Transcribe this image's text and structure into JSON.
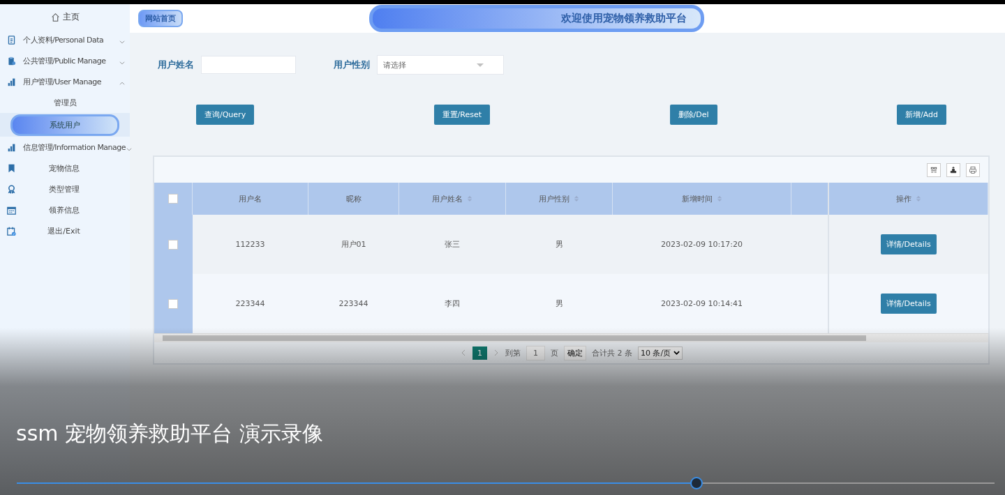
{
  "sidebar": {
    "home": "主页",
    "items": [
      {
        "kind": "group",
        "label": "个人资料/Personal Data",
        "expanded": false
      },
      {
        "kind": "group",
        "label": "公共管理/Public Manage",
        "expanded": false
      },
      {
        "kind": "group",
        "label": "用户管理/User Manage",
        "expanded": true,
        "children": [
          {
            "label": "管理员",
            "selected": false
          },
          {
            "label": "系统用户",
            "selected": true
          }
        ]
      },
      {
        "kind": "group",
        "label": "信息管理/Information Manage",
        "expanded": false
      },
      {
        "kind": "link",
        "label": "宠物信息"
      },
      {
        "kind": "link",
        "label": "类型管理"
      },
      {
        "kind": "link",
        "label": "领养信息"
      },
      {
        "kind": "link",
        "label": "退出/Exit"
      }
    ]
  },
  "header": {
    "home_link": "网站首页",
    "title": "欢迎使用宠物领养救助平台"
  },
  "filters": [
    {
      "kind": "text",
      "label": "用户姓名"
    },
    {
      "kind": "select",
      "label": "用户性别",
      "placeholder": "请选择"
    }
  ],
  "buttons": [
    "查询/Query",
    "重置/Reset",
    "删除/Del",
    "新增/Add"
  ],
  "table": {
    "header_checked": false,
    "columns": [
      {
        "label": "用户名",
        "sortable": false
      },
      {
        "label": "昵称",
        "sortable": false
      },
      {
        "label": "用户姓名",
        "sortable": true
      },
      {
        "label": "用户性别",
        "sortable": true
      },
      {
        "label": "新增时间",
        "sortable": true
      },
      {
        "sortable": false
      },
      {
        "label": "操作",
        "sortable": true
      }
    ],
    "rows": [
      {
        "checked": false,
        "cells": [
          "112233",
          "用户01",
          "张三",
          "男",
          "2023-02-09 10:17:20",
          ""
        ],
        "action": "详情/Details"
      },
      {
        "checked": false,
        "cells": [
          "223344",
          "223344",
          "李四",
          "男",
          "2023-02-09 10:14:41",
          ""
        ],
        "action": "详情/Details"
      }
    ]
  },
  "pagination": {
    "pages": [
      {
        "label": "1",
        "selected": true
      }
    ],
    "goto_label": "到第",
    "goto_value": "1",
    "page_unit": "页",
    "confirm": "确定",
    "total": "合计共 2 条",
    "page_size": "10 条/页"
  },
  "video": {
    "title": "ssm 宠物领养救助平台 演示录像",
    "progress": {
      "level": 0.693
    }
  }
}
